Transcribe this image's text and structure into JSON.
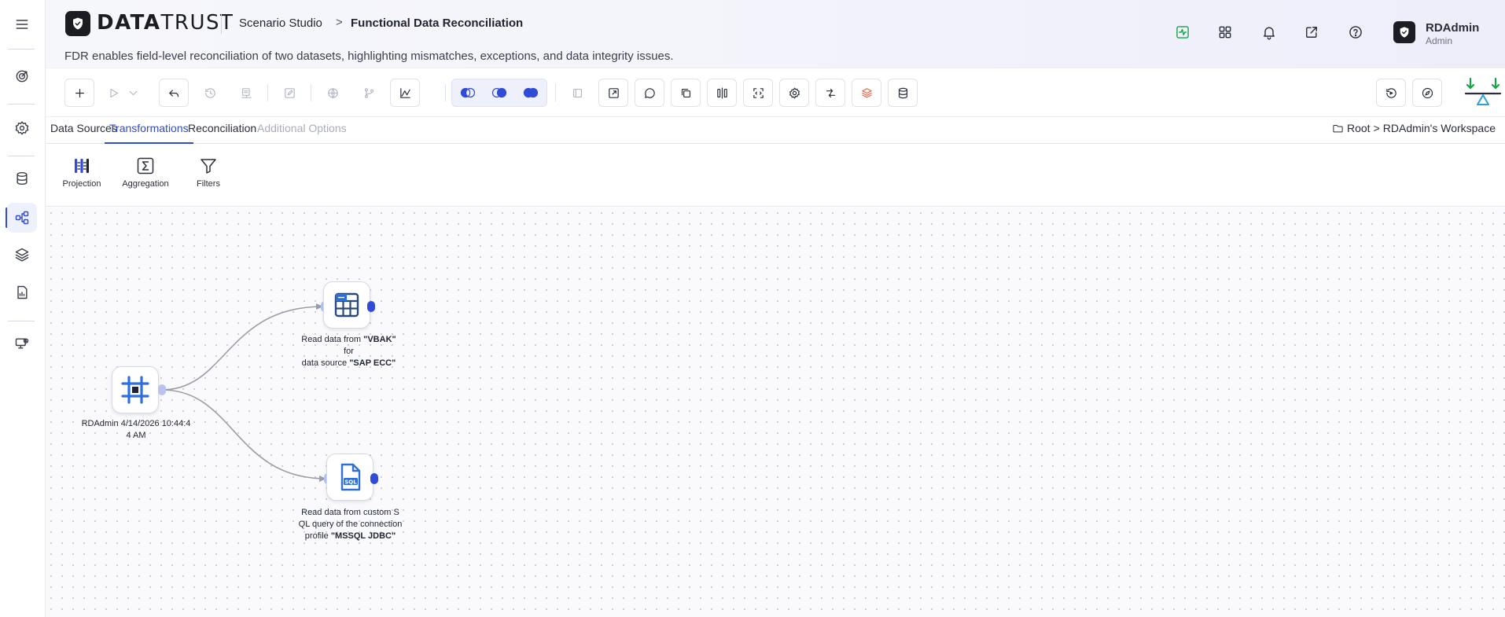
{
  "rail": {
    "icons": [
      "menu-icon",
      "target-icon",
      "settings-icon",
      "database-icon",
      "workflow-icon",
      "layers-icon",
      "report-icon",
      "monitor-icon"
    ]
  },
  "header": {
    "brand_bold": "DATA",
    "brand_regular": "TRUST",
    "breadcrumb_studio": "Scenario Studio",
    "breadcrumb_separator": ">",
    "title": "Functional Data Reconciliation",
    "description": "FDR enables field-level reconciliation of two datasets, highlighting mismatches, exceptions, and data integrity issues.",
    "user": {
      "name": "RDAdmin",
      "role": "Admin"
    },
    "icons": [
      "activity-icon",
      "grid-icon",
      "bell-icon",
      "external-link-icon",
      "help-icon"
    ]
  },
  "tabs": [
    {
      "label": "Data Sources",
      "state": "normal"
    },
    {
      "label": "Transformations",
      "state": "active"
    },
    {
      "label": "Reconciliation",
      "state": "normal"
    },
    {
      "label": "Additional Options",
      "state": "disabled"
    }
  ],
  "path": {
    "root": "Root",
    "separator": ">",
    "workspace": "RDAdmin's Workspace"
  },
  "palette": [
    {
      "label": "Projection"
    },
    {
      "label": "Aggregation"
    },
    {
      "label": "Filters"
    }
  ],
  "nodes": {
    "start": {
      "line1": "RDAdmin 4/14/2026 10:44:4",
      "line2": "4 AM"
    },
    "vbak": {
      "prefix": "Read data from ",
      "table": "\"VBAK\"",
      "middle": " for",
      "line2_prefix": "data source ",
      "source": "\"SAP ECC\""
    },
    "sql": {
      "line1": "Read data from custom S",
      "line2": "QL query of the connection",
      "line3_prefix": "profile ",
      "profile": "\"MSSQL JDBC\""
    }
  },
  "colors": {
    "accent": "#2f4bd8",
    "port_in": "#b8c3f2",
    "activity_green": "#16a34a",
    "layers_red": "#ef6a4c"
  }
}
